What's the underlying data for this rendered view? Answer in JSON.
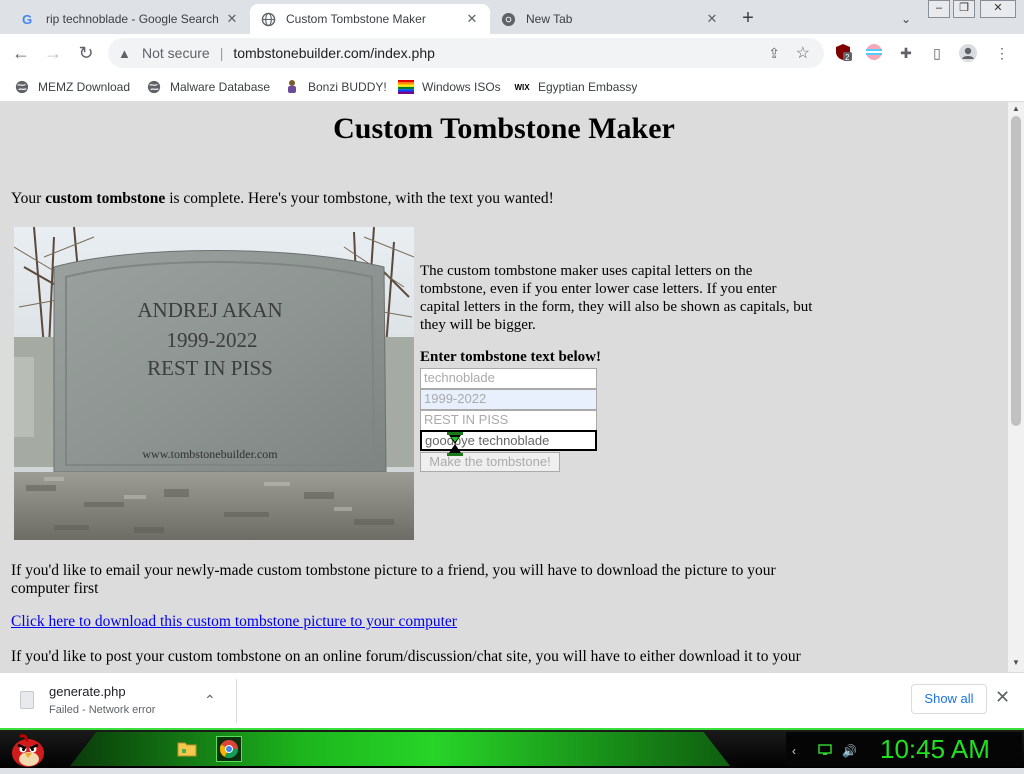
{
  "window": {
    "minimize": "‒",
    "restore": "❐",
    "close": "✕"
  },
  "tabs": [
    {
      "title": "rip technoblade - Google Search",
      "icon": "google-icon"
    },
    {
      "title": "Custom Tombstone Maker",
      "icon": "globe-icon"
    },
    {
      "title": "New Tab",
      "icon": "chrome-icon"
    }
  ],
  "toolbar": {
    "security": "Not secure",
    "url": "tombstonebuilder.com/index.php",
    "extension_badge": "2"
  },
  "bookmarks": [
    {
      "label": "MEMZ Download",
      "icon": "globe-icon"
    },
    {
      "label": "Malware Database",
      "icon": "globe-icon"
    },
    {
      "label": "Bonzi BUDDY!",
      "icon": "bonzi-icon"
    },
    {
      "label": "Windows ISOs",
      "icon": "windows-icon"
    },
    {
      "label": "Egyptian Embassy",
      "icon": "wix-icon"
    }
  ],
  "page": {
    "heading": "Custom Tombstone Maker",
    "complete_pre": "Your ",
    "complete_bold": "custom tombstone",
    "complete_post": " is complete. Here's your tombstone, with the text you wanted!",
    "tombstone": {
      "line1": "ANDREJ AKAN",
      "line2": "1999-2022",
      "line3": "REST IN PISS",
      "site": "www.tombstonebuilder.com"
    },
    "description": "The custom tombstone maker uses capital letters on the tombstone, even if you enter lower case letters. If you enter capital letters in the form, they will also be shown as capitals, but they will be bigger.",
    "enter_label": "Enter tombstone text below!",
    "inputs": [
      "technoblade",
      "1999-2022",
      "REST IN PISS",
      "goodbye technoblade"
    ],
    "button": "Make the tombstone!",
    "email_text": "If you'd like to email your newly-made custom tombstone picture to a friend, you will have to download the picture to your computer first",
    "download_link": "Click here to download this custom tombstone picture to your computer",
    "forum_text": "If you'd like to post your custom tombstone on an online forum/discussion/chat site, you will have to either download it to your"
  },
  "downloads": {
    "filename": "generate.php",
    "status": "Failed - Network error",
    "show_all": "Show all"
  },
  "taskbar": {
    "clock": "10:45 AM"
  },
  "colors": {
    "clock": "#20e020",
    "link": "#0000ee",
    "page_bg": "#dcdcdc"
  }
}
